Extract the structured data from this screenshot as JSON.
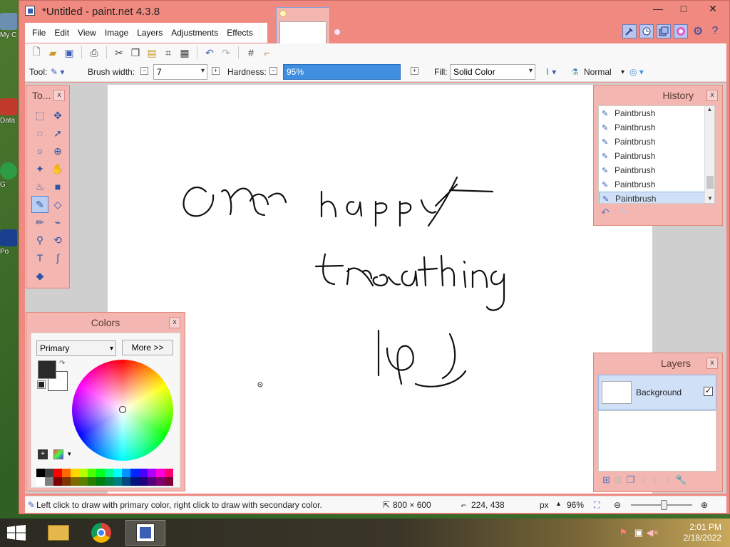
{
  "window": {
    "title": "*Untitled - paint.net 4.3.8",
    "minimize": "—",
    "maximize": "□",
    "close": "✕"
  },
  "desktop_icons": [
    {
      "label": "My C",
      "color": "#6a8fb0"
    },
    {
      "label": "Data",
      "color": "#c0392b"
    },
    {
      "label": "G",
      "color": "#2e9c44"
    },
    {
      "label": "Po",
      "color": "#1b3f8f"
    }
  ],
  "menu": [
    "File",
    "Edit",
    "View",
    "Image",
    "Layers",
    "Adjustments",
    "Effects"
  ],
  "toolbar2": {
    "tool_label": "Tool:",
    "brush_width_label": "Brush width:",
    "brush_width_value": "7",
    "hardness_label": "Hardness:",
    "hardness_value": "95%",
    "fill_label": "Fill:",
    "fill_value": "Solid Color",
    "blend_value": "Normal"
  },
  "tools_panel": {
    "title": "To...",
    "close": "x",
    "tools": [
      {
        "name": "rectangle-select-icon",
        "glyph": "⬚"
      },
      {
        "name": "move-selected-pixels-icon",
        "glyph": "✥"
      },
      {
        "name": "lasso-select-icon",
        "glyph": "◌"
      },
      {
        "name": "move-selection-icon",
        "glyph": "➚"
      },
      {
        "name": "ellipse-select-icon",
        "glyph": "○"
      },
      {
        "name": "zoom-icon",
        "glyph": "⊕"
      },
      {
        "name": "magic-wand-icon",
        "glyph": "✦"
      },
      {
        "name": "pan-icon",
        "glyph": "✋"
      },
      {
        "name": "paint-bucket-icon",
        "glyph": "♨"
      },
      {
        "name": "gradient-icon",
        "glyph": "■"
      },
      {
        "name": "paintbrush-icon",
        "glyph": "✎"
      },
      {
        "name": "eraser-icon",
        "glyph": "◇"
      },
      {
        "name": "pencil-icon",
        "glyph": "✏"
      },
      {
        "name": "color-picker-icon",
        "glyph": "⌁"
      },
      {
        "name": "clone-stamp-icon",
        "glyph": "⚲"
      },
      {
        "name": "recolor-icon",
        "glyph": "⟲"
      },
      {
        "name": "text-icon",
        "glyph": "T"
      },
      {
        "name": "line-curve-icon",
        "glyph": "∫"
      },
      {
        "name": "shapes-icon",
        "glyph": "◆"
      }
    ]
  },
  "history": {
    "title": "History",
    "close": "x",
    "items": [
      "Paintbrush",
      "Paintbrush",
      "Paintbrush",
      "Paintbrush",
      "Paintbrush",
      "Paintbrush",
      "Paintbrush"
    ],
    "selected_index": 6
  },
  "layers": {
    "title": "Layers",
    "close": "x",
    "items": [
      {
        "name": "Background",
        "visible_check": "✓"
      }
    ]
  },
  "colors": {
    "title": "Colors",
    "close": "x",
    "mode": "Primary",
    "more_button": "More >>",
    "primary_color": "#2a2a2a",
    "secondary_color": "#ffffff",
    "palette": [
      "#000000",
      "#404040",
      "#ff0000",
      "#ff6a00",
      "#ffd800",
      "#b6ff00",
      "#4cff00",
      "#00ff21",
      "#00ff90",
      "#00ffff",
      "#0094ff",
      "#0026ff",
      "#4800ff",
      "#b200ff",
      "#ff00dc",
      "#ff006e",
      "#ffffff",
      "#808080",
      "#7f0000",
      "#7f3300",
      "#7f6a00",
      "#5b7f00",
      "#267f00",
      "#007f0e",
      "#007f46",
      "#007f7f",
      "#004a7f",
      "#00137f",
      "#21007f",
      "#57007f",
      "#7f006e",
      "#7f0037"
    ]
  },
  "status": {
    "hint": "Left click to draw with primary color, right click to draw with secondary color.",
    "image_size": "800 × 600",
    "cursor_pos": "224, 438",
    "units": "px",
    "zoom": "96%"
  },
  "taskbar": {
    "time": "2:01 PM",
    "date": "2/18/2022"
  }
}
